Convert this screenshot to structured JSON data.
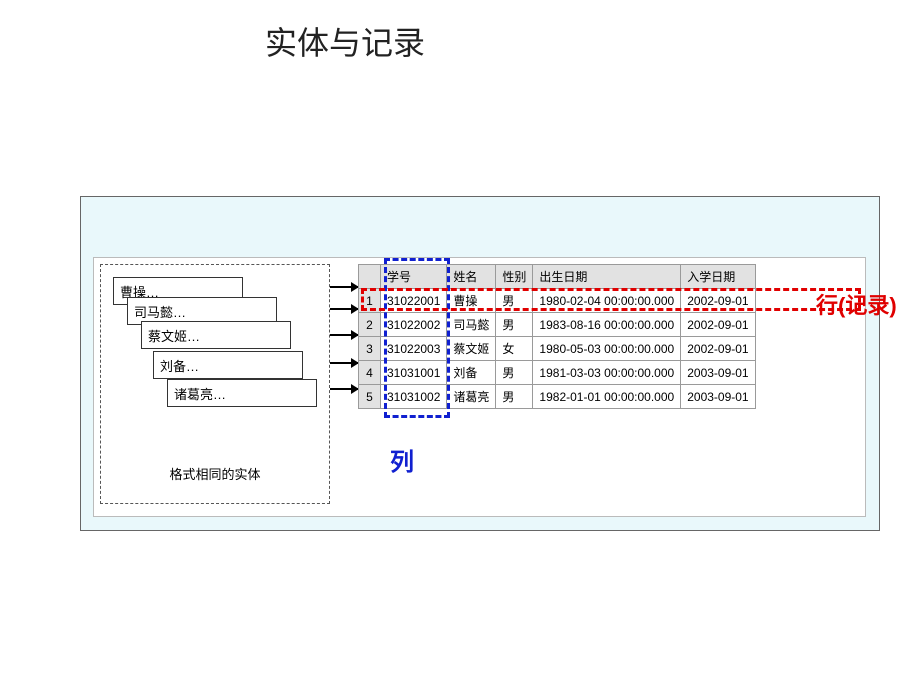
{
  "title": "实体与记录",
  "entities": {
    "cards": [
      "曹操…",
      "司马懿…",
      "蔡文姬…",
      "刘备…",
      "诸葛亮…"
    ],
    "caption": "格式相同的实体"
  },
  "table": {
    "headers": [
      "学号",
      "姓名",
      "性别",
      "出生日期",
      "入学日期"
    ],
    "rows": [
      {
        "n": "1",
        "id": "31022001",
        "name": "曹操",
        "sex": "男",
        "birth": "1980-02-04 00:00:00.000",
        "enroll": "2002-09-01"
      },
      {
        "n": "2",
        "id": "31022002",
        "name": "司马懿",
        "sex": "男",
        "birth": "1983-08-16 00:00:00.000",
        "enroll": "2002-09-01"
      },
      {
        "n": "3",
        "id": "31022003",
        "name": "蔡文姬",
        "sex": "女",
        "birth": "1980-05-03 00:00:00.000",
        "enroll": "2002-09-01"
      },
      {
        "n": "4",
        "id": "31031001",
        "name": "刘备",
        "sex": "男",
        "birth": "1981-03-03 00:00:00.000",
        "enroll": "2003-09-01"
      },
      {
        "n": "5",
        "id": "31031002",
        "name": "诸葛亮",
        "sex": "男",
        "birth": "1982-01-01 00:00:00.000",
        "enroll": "2003-09-01"
      }
    ]
  },
  "labels": {
    "column": "列",
    "row": "行(记录)"
  }
}
